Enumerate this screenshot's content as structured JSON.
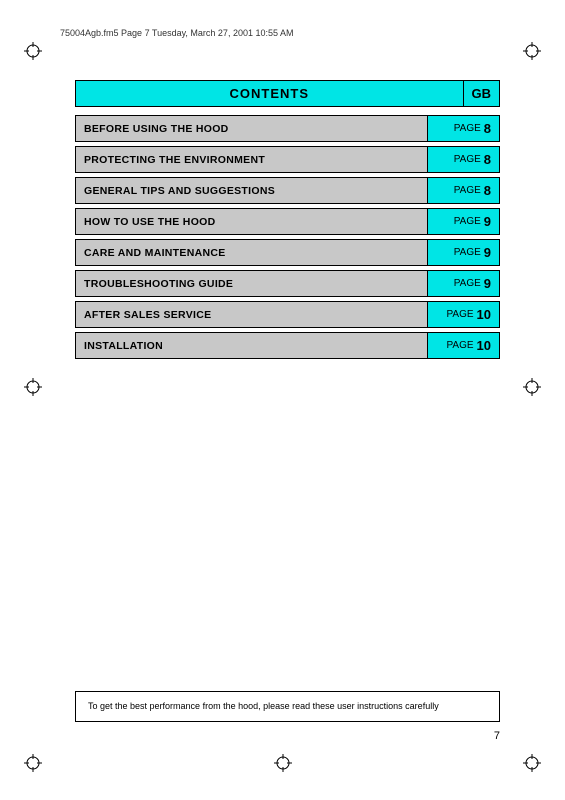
{
  "header": {
    "file_info": "75004Agb.fm5  Page 7  Tuesday, March 27, 2001  10:55 AM"
  },
  "contents": {
    "title": "CONTENTS",
    "gb_label": "GB"
  },
  "toc_rows": [
    {
      "label": "BEFORE USING THE HOOD",
      "page_text": "PAGE",
      "page_num": "8"
    },
    {
      "label": "PROTECTING THE ENVIRONMENT",
      "page_text": "PAGE",
      "page_num": "8"
    },
    {
      "label": "GENERAL TIPS AND SUGGESTIONS",
      "page_text": "PAGE",
      "page_num": "8"
    },
    {
      "label": "HOW TO USE THE HOOD",
      "page_text": "PAGE",
      "page_num": "9"
    },
    {
      "label": "CARE AND MAINTENANCE",
      "page_text": "PAGE",
      "page_num": "9"
    },
    {
      "label": "TROUBLESHOOTING GUIDE",
      "page_text": "PAGE",
      "page_num": "9"
    },
    {
      "label": "AFTER SALES SERVICE",
      "page_text": "PAGE",
      "page_num": "10"
    },
    {
      "label": "INSTALLATION",
      "page_text": "PAGE",
      "page_num": "10"
    }
  ],
  "notice": {
    "text": "To get the best performance from the hood, please read these user instructions carefully"
  },
  "page_number": "7"
}
